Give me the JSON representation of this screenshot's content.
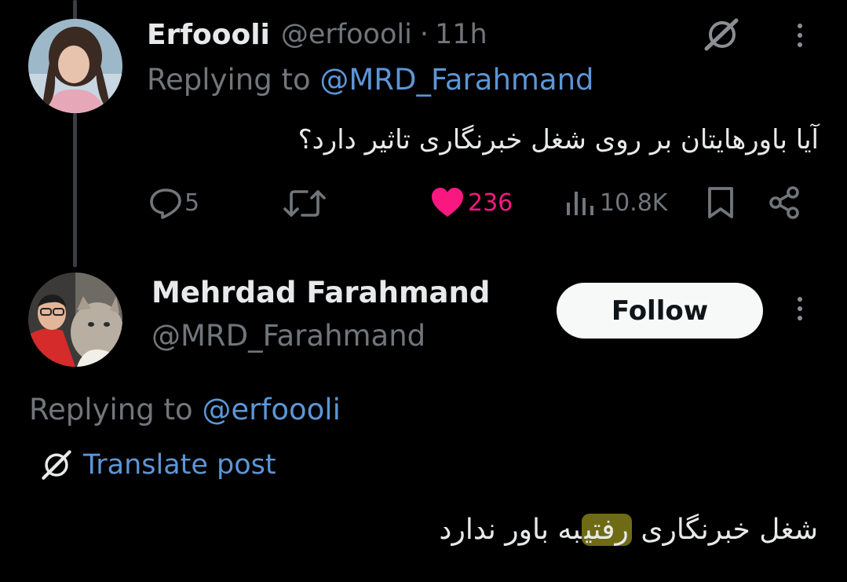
{
  "post1": {
    "display_name": "Erfoooli",
    "handle": "@erfoooli",
    "separator": "·",
    "time": "11h",
    "replying_prefix": "Replying to",
    "replying_to": "@MRD_Farahmand",
    "text": "آیا باورهایتان بر روی شغل خبرنگاری تاثیر دارد؟",
    "replies": "5",
    "likes": "236",
    "views": "10.8K",
    "icons": [
      "grok-icon",
      "more-icon",
      "reply-icon",
      "retweet-icon",
      "heart-icon",
      "views-icon",
      "bookmark-icon",
      "share-icon"
    ]
  },
  "post2": {
    "display_name": "Mehrdad Farahmand",
    "handle": "@MRD_Farahmand",
    "follow_label": "Follow",
    "replying_prefix": "Replying to",
    "replying_to": "@erfoooli",
    "translate_label": "Translate post",
    "text_before": "شغل خبرنگاری ",
    "text_highlight": "رفتی",
    "text_after": "به باور ندارد"
  },
  "colors": {
    "background": "#000000",
    "text": "#e7e9ea",
    "muted": "#71767b",
    "link": "#5c96d6",
    "like": "#f91880",
    "highlight": "#6f6b14"
  }
}
